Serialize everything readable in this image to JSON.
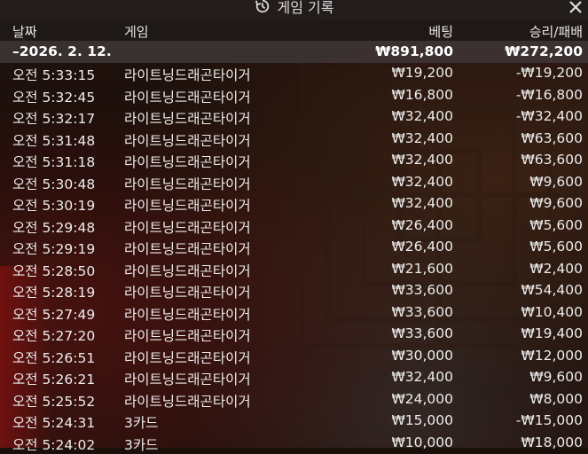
{
  "header": {
    "title": "게임 기록"
  },
  "columns": {
    "date": "날짜",
    "game": "게임",
    "bet": "베팅",
    "result": "승리/패배"
  },
  "summary": {
    "date": "–2026. 2. 12.",
    "bet": "₩891,800",
    "result": "₩272,200"
  },
  "rows": [
    {
      "time": "오전 5:33:15",
      "game": "라이트닝드래곤타이거",
      "bet": "₩19,200",
      "result": "-₩19,200"
    },
    {
      "time": "오전 5:32:45",
      "game": "라이트닝드래곤타이거",
      "bet": "₩16,800",
      "result": "-₩16,800"
    },
    {
      "time": "오전 5:32:17",
      "game": "라이트닝드래곤타이거",
      "bet": "₩32,400",
      "result": "-₩32,400"
    },
    {
      "time": "오전 5:31:48",
      "game": "라이트닝드래곤타이거",
      "bet": "₩32,400",
      "result": "₩63,600"
    },
    {
      "time": "오전 5:31:18",
      "game": "라이트닝드래곤타이거",
      "bet": "₩32,400",
      "result": "₩63,600"
    },
    {
      "time": "오전 5:30:48",
      "game": "라이트닝드래곤타이거",
      "bet": "₩32,400",
      "result": "₩9,600"
    },
    {
      "time": "오전 5:30:19",
      "game": "라이트닝드래곤타이거",
      "bet": "₩32,400",
      "result": "₩9,600"
    },
    {
      "time": "오전 5:29:48",
      "game": "라이트닝드래곤타이거",
      "bet": "₩26,400",
      "result": "₩5,600"
    },
    {
      "time": "오전 5:29:19",
      "game": "라이트닝드래곤타이거",
      "bet": "₩26,400",
      "result": "₩5,600"
    },
    {
      "time": "오전 5:28:50",
      "game": "라이트닝드래곤타이거",
      "bet": "₩21,600",
      "result": "₩2,400"
    },
    {
      "time": "오전 5:28:19",
      "game": "라이트닝드래곤타이거",
      "bet": "₩33,600",
      "result": "₩54,400"
    },
    {
      "time": "오전 5:27:49",
      "game": "라이트닝드래곤타이거",
      "bet": "₩33,600",
      "result": "₩10,400"
    },
    {
      "time": "오전 5:27:20",
      "game": "라이트닝드래곤타이거",
      "bet": "₩33,600",
      "result": "₩19,400"
    },
    {
      "time": "오전 5:26:51",
      "game": "라이트닝드래곤타이거",
      "bet": "₩30,000",
      "result": "₩12,000"
    },
    {
      "time": "오전 5:26:21",
      "game": "라이트닝드래곤타이거",
      "bet": "₩32,400",
      "result": "₩9,600"
    },
    {
      "time": "오전 5:25:52",
      "game": "라이트닝드래곤타이거",
      "bet": "₩24,000",
      "result": "₩8,000"
    },
    {
      "time": "오전 5:24:31",
      "game": "3카드",
      "bet": "₩15,000",
      "result": "-₩15,000"
    },
    {
      "time": "오전 5:24:02",
      "game": "3카드",
      "bet": "₩10,000",
      "result": "₩18,000"
    }
  ],
  "icons": {
    "title": "history-icon",
    "close": "close-icon"
  }
}
